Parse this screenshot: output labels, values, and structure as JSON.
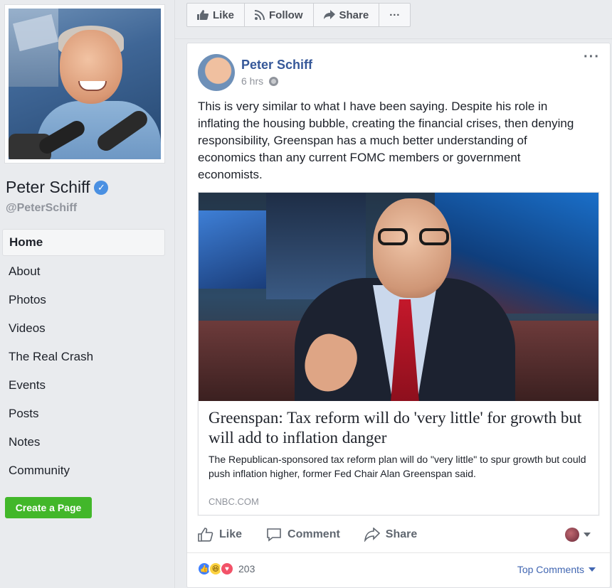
{
  "page": {
    "name": "Peter Schiff",
    "handle": "@PeterSchiff"
  },
  "nav": {
    "items": [
      "Home",
      "About",
      "Photos",
      "Videos",
      "The Real Crash",
      "Events",
      "Posts",
      "Notes",
      "Community"
    ],
    "active": "Home"
  },
  "create_page_label": "Create a Page",
  "actionbar": {
    "like": "Like",
    "follow": "Follow",
    "share": "Share",
    "more": "···"
  },
  "post": {
    "author": "Peter Schiff",
    "time": "6 hrs",
    "more": "···",
    "text": "This is very similar to what I have been saying. Despite his role in inflating the housing bubble, creating the financial crises, then denying responsibility, Greenspan has a much better understanding of economics than any current FOMC members or government economists.",
    "link": {
      "title": "Greenspan: Tax reform will do 'very little' for growth but will add to inflation danger",
      "description": "The Republican-sponsored tax reform plan will do \"very little\" to spur growth but could push inflation higher, former Fed Chair Alan Greenspan said.",
      "domain": "CNBC.COM"
    },
    "actions": {
      "like": "Like",
      "comment": "Comment",
      "share": "Share"
    },
    "reactions": {
      "count": "203",
      "types": [
        "like",
        "haha",
        "love"
      ]
    },
    "top_comments": "Top Comments"
  },
  "colors": {
    "link_blue": "#365899",
    "create_green": "#42b72a",
    "verified_blue": "#4a90e2"
  }
}
